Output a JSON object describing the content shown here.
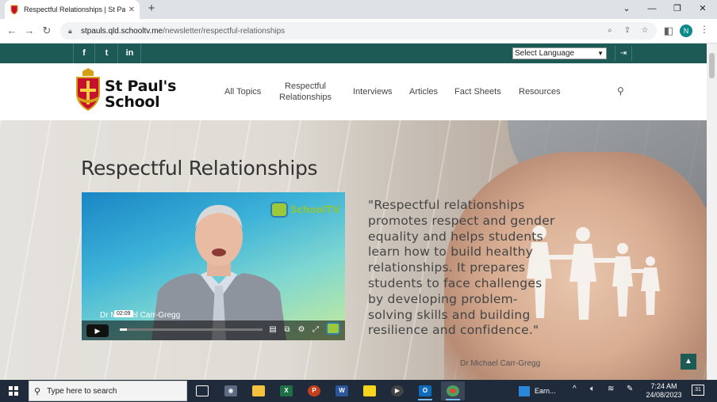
{
  "browser": {
    "tab_title": "Respectful Relationships | St Paul'",
    "tab_close": "✕",
    "new_tab": "+",
    "url_host": "stpauls.qld.schooltv.me",
    "url_path": "/newsletter/respectful-relationships",
    "profile_initial": "N"
  },
  "topbar": {
    "social": [
      "f",
      "t",
      "in"
    ],
    "language_select": "Select Language"
  },
  "header": {
    "school_name_line1": "St Paul's",
    "school_name_line2": "School",
    "nav": [
      {
        "label_line1": "All Topics",
        "label_line2": ""
      },
      {
        "label_line1": "Respectful",
        "label_line2": "Relationships"
      },
      {
        "label_line1": "Interviews",
        "label_line2": ""
      },
      {
        "label_line1": "Articles",
        "label_line2": ""
      },
      {
        "label_line1": "Fact Sheets",
        "label_line2": ""
      },
      {
        "label_line1": "Resources",
        "label_line2": ""
      }
    ]
  },
  "hero": {
    "title": "Respectful Relationships",
    "quote": "\"Respectful relationships promotes respect and gender equality and helps students learn how to build healthy relationships. It prepares students to face challenges by developing problem-solving skills and building resilience and confidence.\"",
    "attribution": "Dr Michael Carr-Gregg"
  },
  "video": {
    "brand": "SchoolTV",
    "presenter_name": "Dr Michael Carr-Gregg",
    "time_bubble": "02:09",
    "progress_fraction": 0.05
  },
  "taskbar": {
    "search_placeholder": "Type here to search",
    "earn_label": "Earn...",
    "time": "7:24 AM",
    "date": "24/08/2023",
    "notification_count": "31"
  },
  "colors": {
    "brand_teal": "#1d5a56",
    "taskbar": "#1f2a3a"
  }
}
